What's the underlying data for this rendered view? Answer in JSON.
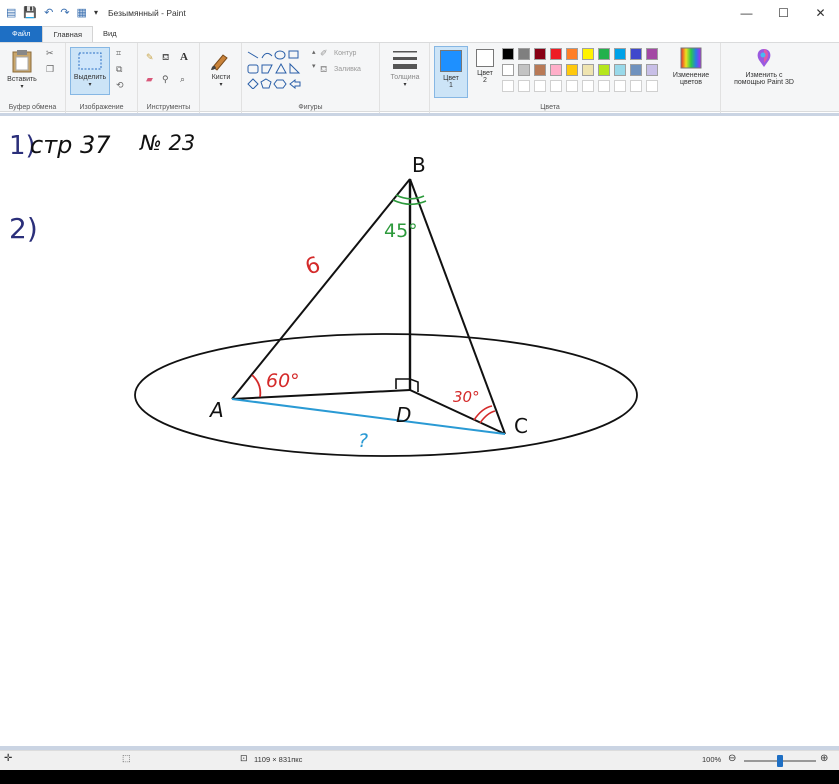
{
  "window": {
    "title": "Безымянный - Paint",
    "minimize": "—",
    "maximize": "☐",
    "close": "✕"
  },
  "tabs": [
    {
      "label": "Файл"
    },
    {
      "label": "Главная"
    },
    {
      "label": "Вид"
    }
  ],
  "ribbon": {
    "clipboard": {
      "paste": "Вставить",
      "group": "Буфер обмена"
    },
    "image": {
      "select": "Выделить",
      "group": "Изображение"
    },
    "tools": {
      "group": "Инструменты"
    },
    "brushes": {
      "label": "Кисти"
    },
    "shapes": {
      "outline": "Контур",
      "fill": "Заливка",
      "group": "Фигуры"
    },
    "size": {
      "label": "Толщина"
    },
    "color1": {
      "label": "Цвет",
      "num": "1"
    },
    "color2": {
      "label": "Цвет",
      "num": "2"
    },
    "edit_colors": {
      "line1": "Изменение",
      "line2": "цветов"
    },
    "paint3d": {
      "line1": "Изменить с",
      "line2": "помощью Paint 3D"
    },
    "colors_group": "Цвета"
  },
  "palette": {
    "row1": [
      "#000000",
      "#7f7f7f",
      "#880015",
      "#ed1c24",
      "#ff7f27",
      "#fff200",
      "#22b14c",
      "#00a2e8",
      "#3f48cc",
      "#a349a4"
    ],
    "row2": [
      "#ffffff",
      "#c3c3c3",
      "#b97a57",
      "#ffaec9",
      "#ffc90e",
      "#efe4b0",
      "#b5e61d",
      "#99d9ea",
      "#7092be",
      "#c8bfe7"
    ],
    "color1": "#1e90ff",
    "color2": "#ffffff"
  },
  "drawing": {
    "line1_num": "1)",
    "line1_text": "стр 37",
    "line1_task": "№ 23",
    "line2_num": "2)",
    "label_B": "B",
    "label_A": "A",
    "label_C": "C",
    "label_D": "D",
    "side_AB": "6",
    "angle_A": "60°",
    "angle_B": "45°",
    "angle_C": "30°",
    "unknown": "?",
    "colors": {
      "red": "#d42a2a",
      "green": "#2d9a3c",
      "blue": "#2a9ad4",
      "navy": "#2b2f7a"
    }
  },
  "status": {
    "size": "1109 × 831пкс",
    "zoom": "100%",
    "zoom_level": 0.5
  }
}
